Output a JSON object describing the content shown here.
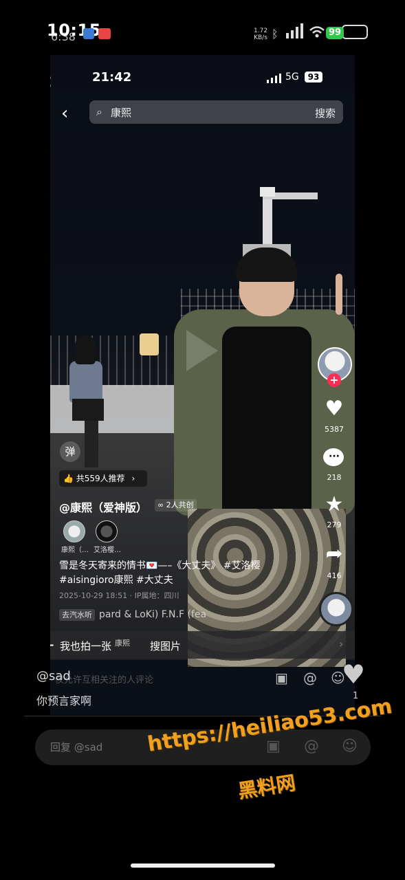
{
  "outer_status": {
    "time": "10:15",
    "ghost_time": "6:38",
    "net_speed_value": "1.72",
    "net_speed_unit": "KB/s",
    "battery": "99"
  },
  "inner_status": {
    "time": "21:42",
    "network": "5G",
    "battery": "93"
  },
  "search": {
    "query": "康熙",
    "button_label": "搜索",
    "back_glyph": "‹",
    "icon": "search-icon"
  },
  "video": {
    "danmaku_label": "弹",
    "recommend_label": "共559人推荐",
    "author": "@康熙（爱神版）",
    "cocreate_label": "2人共创",
    "cocreators": [
      "康熙（…",
      "艾洛樱…"
    ],
    "description_line1": "雪是冬天寄来的情书💌—–《大丈夫》 #艾洛樱",
    "description_line2": "#aisingioro康熙 #大丈夫",
    "meta": "2025-10-29 18:51 · IP属地：四川",
    "music_tag": "去汽水听",
    "music_text": "pard & LoKi)   F.N.F (fea"
  },
  "actions": {
    "likes": "5387",
    "comments": "218",
    "favorites": "279",
    "shares": "416"
  },
  "bottom_strip": {
    "plus": "+",
    "left_label": "我也拍一张",
    "chip": "康熙",
    "right_label": "搜图片"
  },
  "comment": {
    "user": "@sad",
    "hint": "仅允许互相关注的人评论",
    "text": "你预言家啊",
    "like_count": "1",
    "reply_placeholder": "回复 @sad"
  },
  "watermark": {
    "url": "https://heiliao53.com",
    "name": "黑料网"
  },
  "colors": {
    "follow": "#fe2c55",
    "battery_green": "#31c94a",
    "watermark": "#f0a020"
  }
}
